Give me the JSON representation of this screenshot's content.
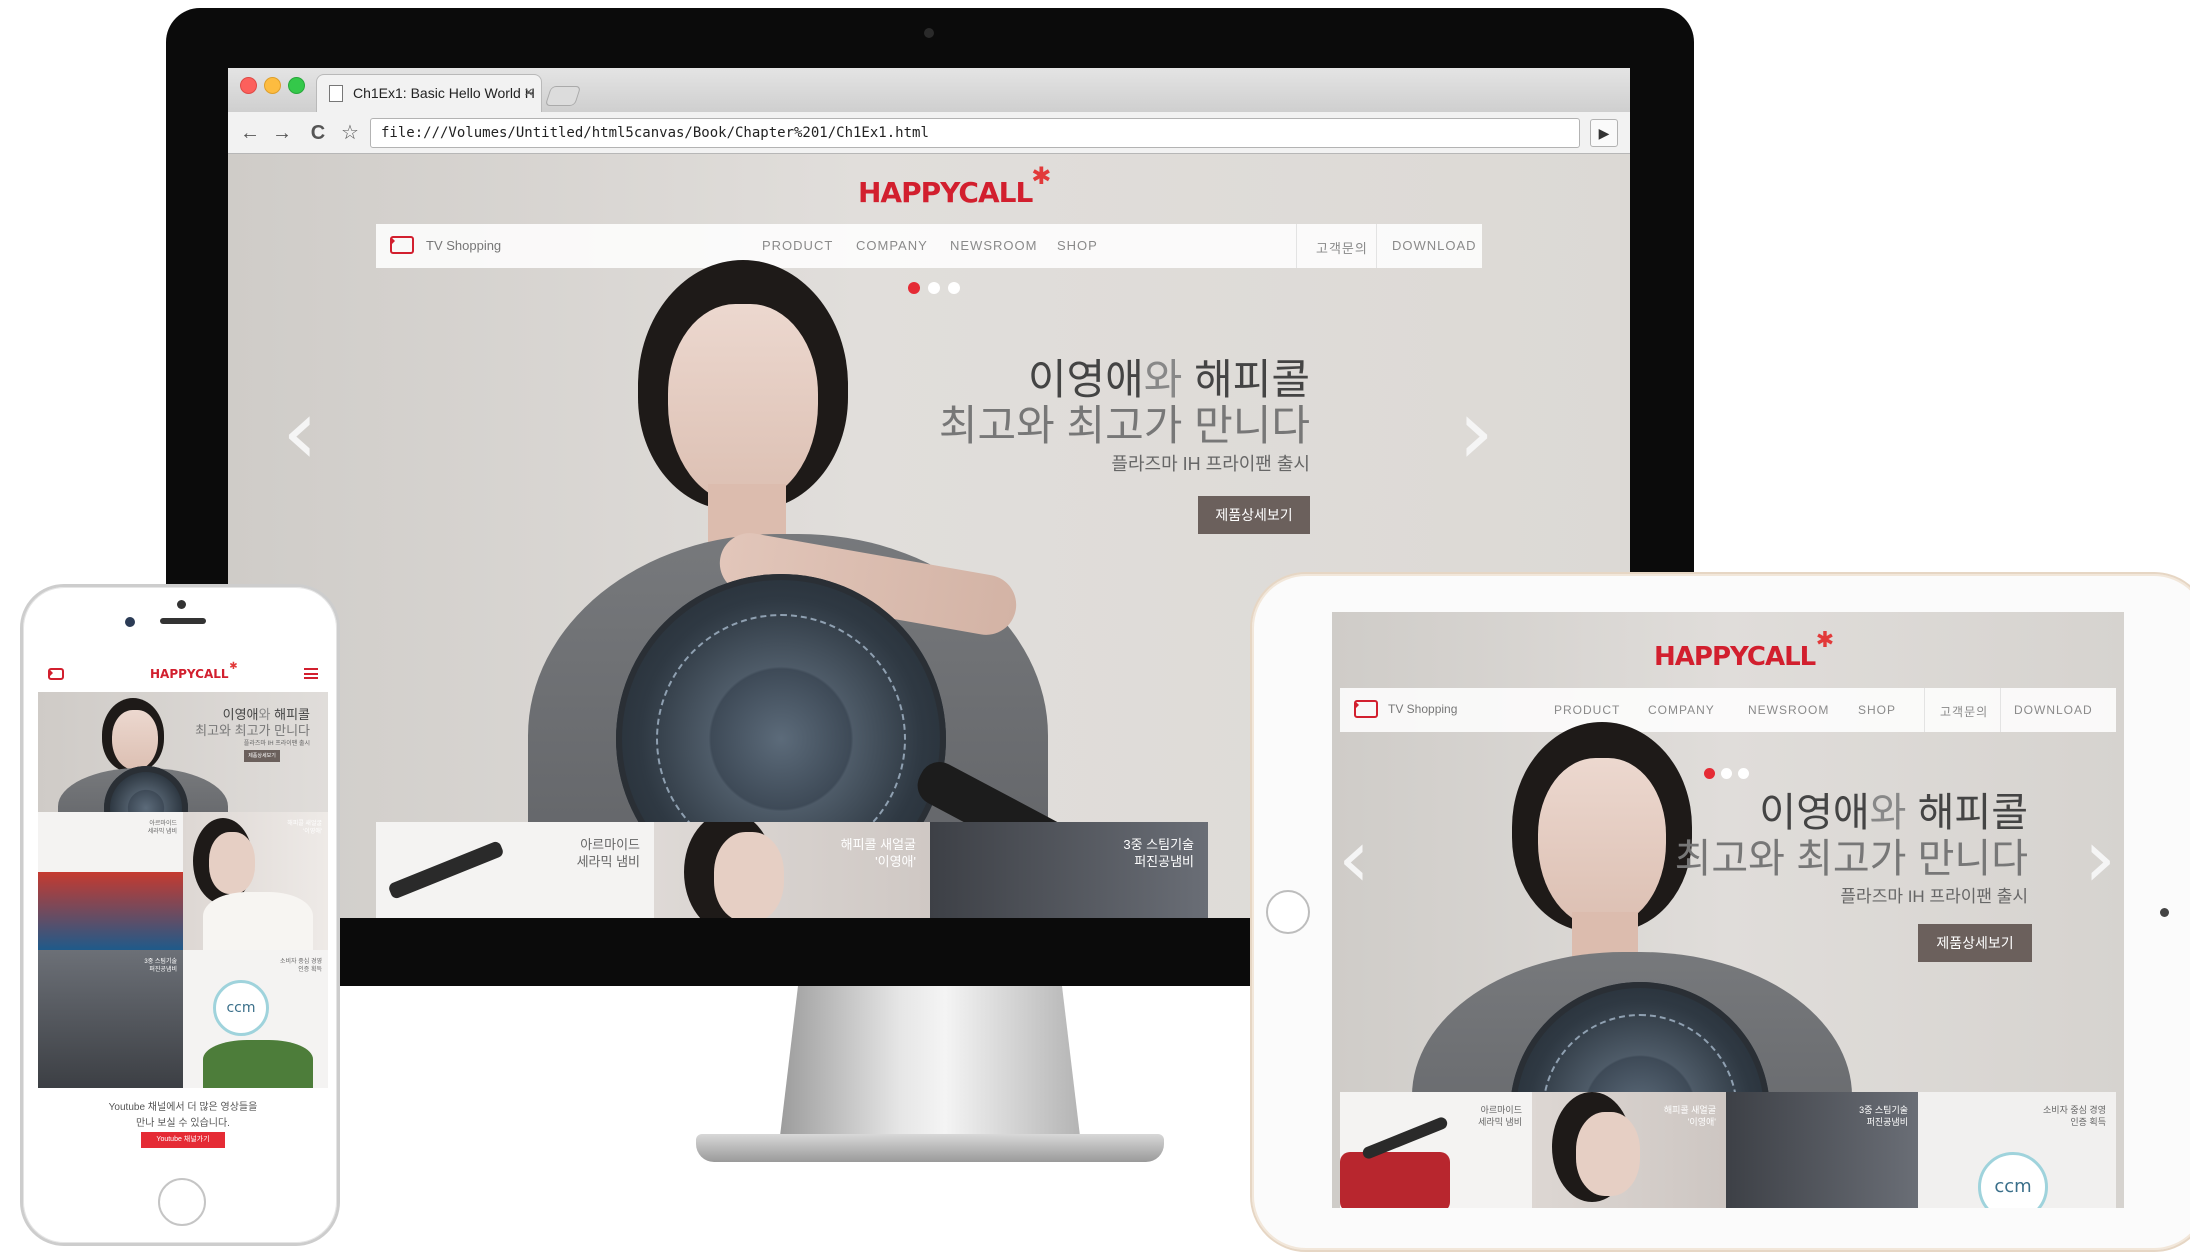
{
  "browser": {
    "tab_title": "Ch1Ex1: Basic Hello World H",
    "tab_close": "×",
    "url": "file:///Volumes/Untitled/html5canvas/Book/Chapter%201/Ch1Ex1.html",
    "back": "←",
    "forward": "→",
    "reload": "C",
    "bookmark": "☆",
    "go": "▶"
  },
  "site": {
    "logo": "HAPPYCALL",
    "logo_star": "✱",
    "nav": {
      "tv_shopping": "TV Shopping",
      "items": [
        "PRODUCT",
        "COMPANY",
        "NEWSROOM",
        "SHOP"
      ],
      "support": "고객문의",
      "download": "DOWNLOAD"
    },
    "hero": {
      "title_line1_a": "이영애",
      "title_line1_b": "와 ",
      "title_line1_c": "해피콜",
      "title_line2": "최고와 최고가 만니다",
      "subtitle": "플라즈마 IH 프라이팬 출시",
      "button": "제품상세보기",
      "prev": "‹",
      "next": "›"
    },
    "thumbs": [
      {
        "line1": "아르마이드",
        "line2": "세라믹 냄비"
      },
      {
        "line1": "해피콜 새얼굴",
        "line2": "'이영애'"
      },
      {
        "line1": "3중 스팀기술",
        "line2": "퍼진공냄비"
      },
      {
        "line1": "소비자 중심 경영",
        "line2": "인증 획득"
      }
    ],
    "ccm": "ccm",
    "youtube": {
      "line1": "Youtube 채널에서 더 많은 영상들을",
      "line2": "만나 보실 수 있습니다.",
      "button": "Youtube 채널가기"
    }
  },
  "colors": {
    "brand_red": "#d21f2e",
    "button_brown": "#6b605c",
    "active_dot": "#e52b35"
  }
}
